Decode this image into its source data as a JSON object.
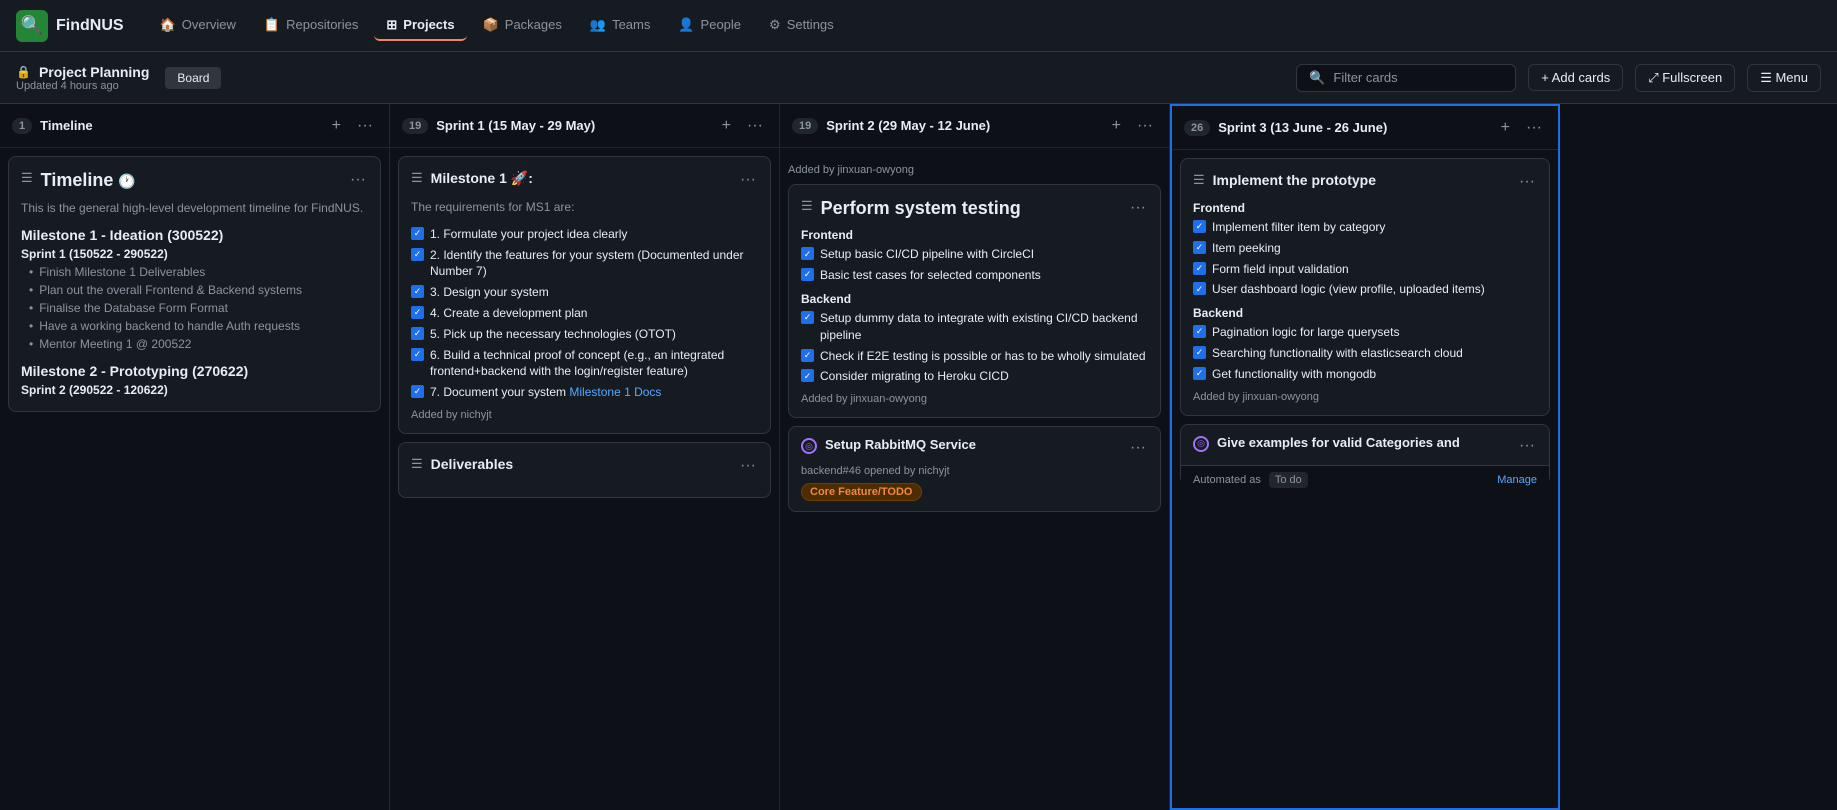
{
  "app": {
    "name": "FindNUS",
    "logo": "🔍"
  },
  "nav": {
    "items": [
      {
        "id": "overview",
        "label": "Overview",
        "icon": "🏠",
        "active": false
      },
      {
        "id": "repositories",
        "label": "Repositories",
        "icon": "📋",
        "active": false
      },
      {
        "id": "projects",
        "label": "Projects",
        "icon": "⊞",
        "active": true
      },
      {
        "id": "packages",
        "label": "Packages",
        "icon": "📦",
        "active": false
      },
      {
        "id": "teams",
        "label": "Teams",
        "icon": "👥",
        "active": false
      },
      {
        "id": "people",
        "label": "People",
        "icon": "👤",
        "active": false
      },
      {
        "id": "settings",
        "label": "Settings",
        "icon": "⚙",
        "active": false
      }
    ]
  },
  "project": {
    "title": "Project Planning",
    "subtitle": "Updated 4 hours ago",
    "filter_placeholder": "Filter cards",
    "add_cards_label": "+ Add cards",
    "fullscreen_label": "⤢ Fullscreen",
    "menu_label": "☰ Menu"
  },
  "board": {
    "columns": [
      {
        "id": "timeline",
        "num": "1",
        "title": "Timeline",
        "cards": [
          {
            "type": "note",
            "icon": "☰",
            "title": "Timeline",
            "has_clock": true,
            "description": "This is the general high-level development timeline for FindNUS.",
            "sections": [
              {
                "heading": "Milestone 1 - Ideation (300522)",
                "sprints": [
                  {
                    "title": "Sprint 1 (150522 - 290522)",
                    "items": [
                      "Finish Milestone 1 Deliverables",
                      "Plan out the overall Frontend & Backend systems",
                      "Finalise the Database Form Format",
                      "Have a working backend to handle Auth requests",
                      "Mentor Meeting 1 @ 200522"
                    ]
                  }
                ]
              },
              {
                "heading": "Milestone 2 - Prototyping (270622)",
                "sprints": [
                  {
                    "title": "Sprint 2 (290522 - 120622)",
                    "items": []
                  }
                ]
              }
            ]
          }
        ]
      },
      {
        "id": "sprint1",
        "num": "19",
        "title": "Sprint 1 (15 May - 29 May)",
        "cards": [
          {
            "type": "note",
            "icon": "☰",
            "title": "Milestone 1 🚀:",
            "description": "The requirements for MS1 are:",
            "checklist": [
              {
                "checked": true,
                "text": "1. Formulate your project idea clearly"
              },
              {
                "checked": true,
                "text": "2. Identify the features for your system (Documented under Number 7)"
              },
              {
                "checked": true,
                "text": "3. Design your system"
              },
              {
                "checked": true,
                "text": "4. Create a development plan"
              },
              {
                "checked": true,
                "text": "5. Pick up the necessary technologies (OTOT)"
              },
              {
                "checked": true,
                "text": "6. Build a technical proof of concept (e.g., an integrated frontend+backend with the login/register feature)"
              },
              {
                "checked": true,
                "text_parts": [
                  "7. Document your system ",
                  "Milestone 1 Docs"
                ],
                "link": "Milestone 1 Docs"
              }
            ],
            "added_by": "Added by nichyjt"
          },
          {
            "type": "note",
            "icon": "☰",
            "title": "Deliverables",
            "truncated": true
          }
        ]
      },
      {
        "id": "sprint2",
        "num": "19",
        "title": "Sprint 2 (29 May - 12 June)",
        "top_added_by": "Added by jinxuan-owyong",
        "cards": [
          {
            "type": "note",
            "icon": "☰",
            "title": "Perform system testing",
            "sections": [
              {
                "heading": "Frontend",
                "items": [
                  {
                    "checked": true,
                    "text": "Setup basic CI/CD pipeline with CircleCI"
                  },
                  {
                    "checked": true,
                    "text": "Basic test cases for selected components"
                  }
                ]
              },
              {
                "heading": "Backend",
                "items": [
                  {
                    "checked": true,
                    "text": "Setup dummy data to integrate with existing CI/CD backend pipeline"
                  },
                  {
                    "checked": true,
                    "text": "Check if E2E testing is possible or has to be wholly simulated"
                  },
                  {
                    "checked": true,
                    "text": "Consider migrating to Heroku CICD"
                  }
                ]
              }
            ],
            "added_by": "Added by jinxuan-owyong"
          },
          {
            "type": "issue",
            "icon_type": "purple",
            "title": "Setup RabbitMQ Service",
            "subtitle": "backend#46 opened by nichyjt",
            "badge": "Core Feature/TODO",
            "badge_type": "orange"
          }
        ]
      },
      {
        "id": "sprint3",
        "num": "26",
        "title": "Sprint 3 (13 June - 26 June)",
        "highlighted": true,
        "cards": [
          {
            "type": "note",
            "icon": "☰",
            "title": "Implement the prototype",
            "sections": [
              {
                "heading": "Frontend",
                "items": [
                  {
                    "checked": true,
                    "text": "Implement filter item by category"
                  },
                  {
                    "checked": true,
                    "text": "Item peeking"
                  },
                  {
                    "checked": true,
                    "text": "Form field input validation"
                  },
                  {
                    "checked": true,
                    "text": "User dashboard logic (view profile, uploaded items)"
                  }
                ]
              },
              {
                "heading": "Backend",
                "items": [
                  {
                    "checked": true,
                    "text": "Pagination logic for large querysets"
                  },
                  {
                    "checked": true,
                    "text": "Searching functionality with elasticsearch cloud"
                  },
                  {
                    "checked": true,
                    "text": "Get functionality with mongodb"
                  }
                ]
              }
            ],
            "added_by": "Added by jinxuan-owyong"
          },
          {
            "type": "issue_auto",
            "icon_type": "purple",
            "title": "Give examples for valid Categories and",
            "title_truncated": true,
            "automated_as": "To do",
            "manage_label": "Manage"
          }
        ]
      }
    ]
  }
}
